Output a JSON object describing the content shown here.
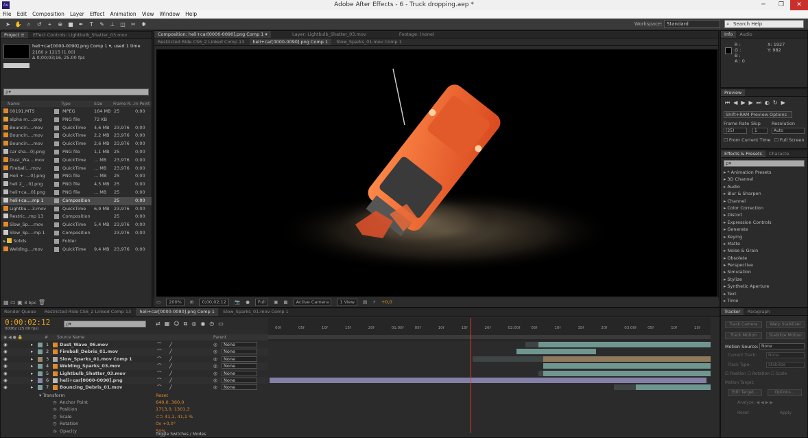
{
  "window": {
    "title": "Adobe After Effects - 6 - Truck dropping.aep *",
    "app_icon": "Ae",
    "minimize": "─",
    "maximize": "❐",
    "close": "✕"
  },
  "menu": [
    "File",
    "Edit",
    "Composition",
    "Layer",
    "Effect",
    "Animation",
    "View",
    "Window",
    "Help"
  ],
  "workspace": {
    "label": "Workspace:",
    "value": "Standard"
  },
  "search_help": {
    "placeholder": "Search Help"
  },
  "project": {
    "tabs": [
      "Project ≡",
      "Effect Controls: Lightbulb_Shatter_03.mov"
    ],
    "selected_name": "heli+car[0000-0090].png Comp 1 ▾",
    "used": ", used 1 time",
    "dims": "2160 x 1215 (1.00)",
    "duration": "Δ 0;00;03;16, 25.00 fps",
    "search_placeholder": "ρ▾",
    "columns": [
      "Name",
      "Type",
      "Size",
      "Frame R...",
      "In Point"
    ],
    "items": [
      {
        "name": "00191.MTS",
        "type": "MPEG",
        "size": "164 MB",
        "fps": "25",
        "in": "0;00",
        "icon": "#e08a2c"
      },
      {
        "name": "alpha m....png",
        "type": "PNG file",
        "size": "72 KB",
        "fps": "",
        "in": "",
        "icon": "#e0a030"
      },
      {
        "name": "Bouncin....mov",
        "type": "QuickTime",
        "size": "4,6 MB",
        "fps": "23,976",
        "in": "0;00",
        "icon": "#e08a2c"
      },
      {
        "name": "Bouncin....mov",
        "type": "QuickTime",
        "size": "2,2 MB",
        "fps": "23,976",
        "in": "0;00",
        "icon": "#e08a2c"
      },
      {
        "name": "Bouncin....mov",
        "type": "QuickTime",
        "size": "2,6 MB",
        "fps": "23,976",
        "in": "0;00",
        "icon": "#e08a2c"
      },
      {
        "name": "car sha...0].png",
        "type": "PNG file",
        "size": "1,1 MB",
        "fps": "25",
        "in": "0;00",
        "icon": "#bbbbbb"
      },
      {
        "name": "Dust_Wa....mov",
        "type": "QuickTime",
        "size": "... MB",
        "fps": "23,976",
        "in": "0;00",
        "icon": "#e08a2c"
      },
      {
        "name": "Fireball....mov",
        "type": "QuickTime",
        "size": "... MB",
        "fps": "23,976",
        "in": "0;00",
        "icon": "#e08a2c"
      },
      {
        "name": "Heli + ....0].png",
        "type": "PNG file",
        "size": "... MB",
        "fps": "25",
        "in": "0;00",
        "icon": "#bbbbbb"
      },
      {
        "name": "heli 2_...0].png",
        "type": "PNG file",
        "size": "4,5 MB",
        "fps": "25",
        "in": "0;00",
        "icon": "#bbbbbb"
      },
      {
        "name": "heli+ca...0].png",
        "type": "PNG file",
        "size": "... MB",
        "fps": "25",
        "in": "0;00",
        "icon": "#bbbbbb"
      },
      {
        "name": "heli+ca....mp 1",
        "type": "Composition",
        "size": "",
        "fps": "25",
        "in": "0;00",
        "icon": "#cccccc",
        "selected": true
      },
      {
        "name": "Lightbu....3.mov",
        "type": "QuickTime",
        "size": "6,9 MB",
        "fps": "23,976",
        "in": "0;00",
        "icon": "#e08a2c"
      },
      {
        "name": "Restric...mp 13",
        "type": "Composition",
        "size": "",
        "fps": "25",
        "in": "0;00",
        "icon": "#cccccc"
      },
      {
        "name": "Slow_Sp....mov",
        "type": "QuickTime",
        "size": "5,4 MB",
        "fps": "23,976",
        "in": "0;00",
        "icon": "#e08a2c"
      },
      {
        "name": "Slow_Sp....mp 1",
        "type": "Composition",
        "size": "",
        "fps": "23,976",
        "in": "0;00",
        "icon": "#cccccc"
      },
      {
        "name": "Solids",
        "type": "Folder",
        "size": "",
        "fps": "",
        "in": "",
        "icon": "#e0c040",
        "folder": true
      },
      {
        "name": "Welding....mov",
        "type": "QuickTime",
        "size": "9,4 MB",
        "fps": "23,976",
        "in": "0;00",
        "icon": "#e08a2c"
      }
    ],
    "bpc": "8 bpc"
  },
  "viewer": {
    "tabs": [
      "Composition: heli+car[0000-0090].png Comp 1 ▾",
      "Layer: Lightbulb_Shatter_03.mov",
      "Footage: (none)"
    ],
    "subtabs": [
      "Restricted Ride CS6_2 Linked Comp 13",
      "heli+car[0000-0090].png Comp 1",
      "Slow_Sparks_01.mov Comp 1"
    ],
    "zoom": "200%",
    "timecode": "0;00;02;12",
    "resolution": "Full",
    "camera": "Active Camera",
    "views": "1 View",
    "exposure": "+0,0"
  },
  "info": {
    "tabs": [
      "Info",
      "Audio"
    ],
    "r": "R :",
    "g": "G :",
    "b": "B :",
    "a": "A : 0",
    "x": "X: 1927",
    "y": "Y: 982"
  },
  "preview": {
    "tab": "Preview",
    "options": "Shift+RAM Preview Options",
    "frame_rate_label": "Frame Rate",
    "skip_label": "Skip",
    "resolution_label": "Resolution",
    "frame_rate": "(25)",
    "skip": "1",
    "resolution": "Auto",
    "from_current": "From Current Time",
    "full_screen": "Full Screen"
  },
  "effects": {
    "tabs": [
      "Effects & Presets",
      "Characte"
    ],
    "search_placeholder": "ρ▾",
    "items": [
      "* Animation Presets",
      "3D Channel",
      "Audio",
      "Blur & Sharpen",
      "Channel",
      "Color Correction",
      "Distort",
      "Expression Controls",
      "Generate",
      "Keying",
      "Matte",
      "Noise & Grain",
      "Obsolete",
      "Perspective",
      "Simulation",
      "Stylize",
      "Synthetic Aperture",
      "Text",
      "Time"
    ]
  },
  "tracker": {
    "tabs": [
      "Tracker",
      "Paragraph"
    ],
    "buttons": [
      "Track Camera",
      "Warp Stabilizer",
      "Track Motion",
      "Stabilize Motion"
    ],
    "motion_source_label": "Motion Source:",
    "motion_source": "None",
    "current_track_label": "Current Track:",
    "current_track": "None",
    "track_type_label": "Track Type:",
    "track_type": "Stabilize",
    "position": "Position",
    "rotation": "Rotation",
    "scale": "Scale",
    "motion_target": "Motion Target:",
    "edit_target": "Edit Target...",
    "options": "Options...",
    "analyze": "Analyze:",
    "reset": "Reset",
    "apply": "Apply"
  },
  "timeline": {
    "tabs": [
      "Render Queue",
      "Restricted Ride CS6_2 Linked Comp 13",
      "heli+car[0000-0090].png Comp 1",
      "Slow_Sparks_01.mov Comp 1"
    ],
    "timecode": "0:00:02:12",
    "frame_info": "00062 (25.00 fps)",
    "search_placeholder": "ρ▾",
    "col_source": "Source Name",
    "col_parent": "Parent",
    "ruler": [
      "00f",
      "05f",
      "10f",
      "15f",
      "20f",
      "01:00f",
      "05f",
      "10f",
      "15f",
      "20f",
      "02:00f",
      "05f",
      "10f",
      "15f",
      "20f",
      "03:00f",
      "05f",
      "10f",
      "15f"
    ],
    "layers": [
      {
        "num": "1",
        "name": "Dust_Wave_06.mov",
        "parent": "None",
        "color": "#7a9e9a",
        "bar_start": 0.61,
        "bar_end": 1.0,
        "bar_color": "#6f9790",
        "pre": 0.58,
        "icon": "#e08a2c"
      },
      {
        "num": "2",
        "name": "Fireball_Debris_01.mov",
        "parent": "None",
        "color": "#7a9e9a",
        "bar_start": 0.56,
        "bar_end": 0.74,
        "bar_color": "#6f9790",
        "pre": 0.56,
        "icon": "#e08a2c"
      },
      {
        "num": "3",
        "name": "Slow_Sparks_01.mov Comp 1",
        "parent": "None",
        "color": "#9e8a6a",
        "bar_start": 0.62,
        "bar_end": 1.0,
        "bar_color": "#8f7a5e",
        "pre": 0.46,
        "icon": "#aaaaaa"
      },
      {
        "num": "4",
        "name": "Welding_Sparks_03.mov",
        "parent": "None",
        "color": "#7a9e9a",
        "bar_start": 0.62,
        "bar_end": 1.0,
        "bar_color": "#6f9790",
        "pre": 0.62,
        "icon": "#e08a2c"
      },
      {
        "num": "5",
        "name": "Lightbulb_Shatter_03.mov",
        "parent": "None",
        "color": "#7a9e9a",
        "bar_start": 0.62,
        "bar_end": 1.0,
        "bar_color": "#6f9790",
        "pre": 0.61,
        "icon": "#e08a2c"
      },
      {
        "num": "6",
        "name": "heli+car[0000-0090].png",
        "parent": "None",
        "color": "#8a86b0",
        "bar_start": 0.0,
        "bar_end": 0.99,
        "bar_color": "#8480a8",
        "pre": 0.0,
        "icon": "#bbbbbb"
      },
      {
        "num": "7",
        "name": "Bouncing_Debris_01.mov",
        "parent": "None",
        "color": "#7a9e9a",
        "bar_start": 0.83,
        "bar_end": 1.0,
        "bar_color": "#6f9790",
        "pre": 0.78,
        "icon": "#e08a2c"
      }
    ],
    "transform": "Transform",
    "reset": "Reset",
    "properties": [
      {
        "name": "Anchor Point",
        "value": "640,0, 360,0"
      },
      {
        "name": "Position",
        "value": "1713,0, 1301,3"
      },
      {
        "name": "Scale",
        "value": "⊂⊃ 41,1, 41,1 %"
      },
      {
        "name": "Rotation",
        "value": "0x +0,0°"
      },
      {
        "name": "Opacity",
        "value": "50%"
      }
    ],
    "toggle": "Toggle Switches / Modes",
    "playhead": 0.455
  },
  "colors": {
    "accent": "#e8a21d",
    "timecode": "#e8a21d",
    "playhead": "#e23b2e"
  }
}
